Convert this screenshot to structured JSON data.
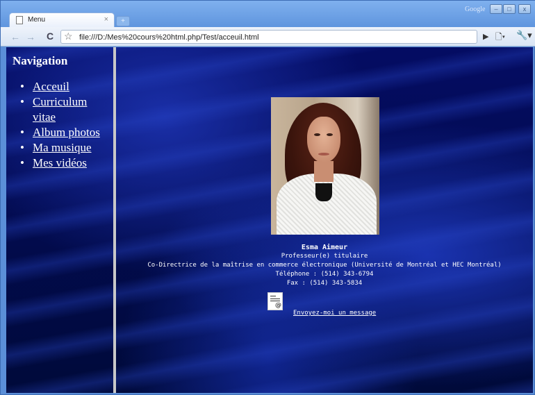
{
  "browser": {
    "tab_title": "Menu",
    "tab_close": "×",
    "new_tab": "+",
    "google_label": "Google",
    "window_buttons": [
      "–",
      "□",
      "x"
    ],
    "back": "←",
    "forward": "→",
    "reload": "C",
    "star": "☆",
    "url": "file:///D:/Mes%20cours%20html.php/Test/acceuil.html",
    "go": "▶",
    "page_menu": "🗋▾",
    "wrench_menu": "🔧▾"
  },
  "sidebar": {
    "title": "Navigation",
    "items": [
      {
        "label": "Acceuil"
      },
      {
        "label": "Curriculum vitae"
      },
      {
        "label": "Album photos"
      },
      {
        "label": "Ma musique"
      },
      {
        "label": "Mes vidéos"
      }
    ]
  },
  "profile": {
    "name": "Esma Aimeur",
    "title": "Professeur(e) titulaire",
    "role": "Co-Directrice de la maîtrise en commerce électronique (Université de Montréal et HEC Montréal)",
    "phone": "Téléphone : (514) 343-6794",
    "fax": "Fax : (514) 343-5834",
    "mail_link": "Envoyez-moi un message"
  }
}
